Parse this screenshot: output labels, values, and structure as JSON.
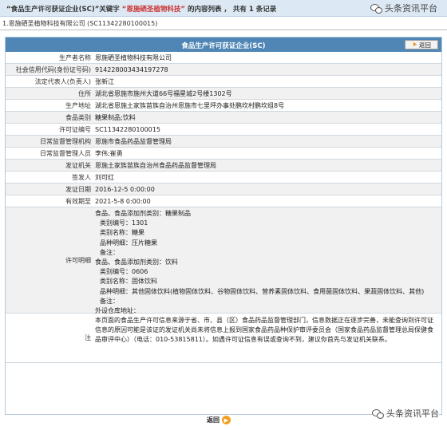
{
  "header": {
    "query_prefix": "“食品生产许可获证企业(SC)”关键字",
    "query_keyword": "“恩施硒圣植物科技”",
    "query_suffix": "的内容列表 ， 共有 1 条记录"
  },
  "watermark": "头条资讯平台",
  "company_line": "1.恩施硒圣植物科技有限公司 (SC11342280100015)",
  "panel": {
    "title": "食品生产许可获证企业(SC)",
    "back_label": "返回"
  },
  "fields": [
    {
      "label": "生产者名称",
      "value": "恩施硒圣植物科技有限公司"
    },
    {
      "label": "社会信用代码(身份证号码)",
      "value": "914228003434197278"
    },
    {
      "label": "法定代表人(负责人)",
      "value": "张新江"
    },
    {
      "label": "住所",
      "value": "湖北省恩施市施州大道66号福星城2号楼1302号"
    },
    {
      "label": "生产地址",
      "value": "湖北省恩施土家族苗族自治州恩施市七里坪办事处鹏坎村鹏坎组8号"
    },
    {
      "label": "食品类别",
      "value": "糖果制品;饮料"
    },
    {
      "label": "许可证编号",
      "value": "SC11342280100015"
    },
    {
      "label": "日常监督管理机构",
      "value": "恩施市食品药品监督管理局"
    },
    {
      "label": "日常监督管理人员",
      "value": "李伟;崔勇"
    },
    {
      "label": "发证机关",
      "value": "恩施土家族苗族自治州食品药品监督管理局"
    },
    {
      "label": "签发人",
      "value": "刘可红"
    },
    {
      "label": "发证日期",
      "value": "2016-12-5 0:00:00"
    },
    {
      "label": "有效期至",
      "value": "2021-5-8 0:00:00"
    }
  ],
  "detail": {
    "label": "许可明细",
    "lines": [
      "食品、食品添加剂类别：糖果制品",
      "类别编号：1301",
      "类别名称：糖果",
      "品种明细：压片糖果",
      "备注：",
      "食品、食品添加剂类别：饮料",
      "类别编号：0606",
      "类别名称：固体饮料",
      "品种明细：其他固体饮料(植物固体饮料、谷物固体饮料、营养素固体饮料、食用菌固体饮料、果蔬固体饮料、其他)",
      "备注：",
      "外设仓库地址："
    ]
  },
  "note": {
    "label": "注",
    "text": "本页面的食品生产许可信息来源于省、市、县（区）食品药品监督管理部门，信息数据正在逐步完善，未能查询到许可证信息的原因可能是该证的发证机关尚未将信息上报到国家食品药品种保护审评委员会（国家食品药品监督管理总局保健食品审评中心）（电话：010-53815811）。如遇许可证信息有误或查询不到，建议你首先与发证机关联系。"
  },
  "footer": {
    "back_label": "返回"
  },
  "colors": {
    "header_bar": "#4f86b5",
    "top_band": "#dce9f4",
    "row_alt": "#f1f1f1",
    "back_icon": "#f0a020"
  }
}
